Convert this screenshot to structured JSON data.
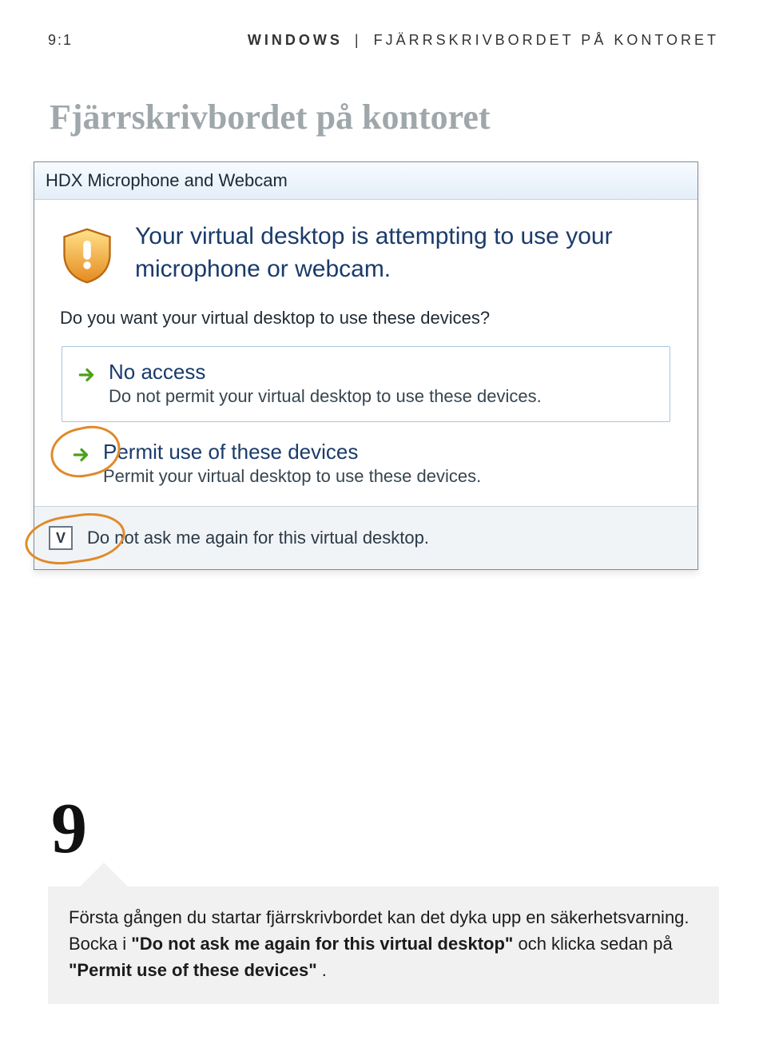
{
  "header": {
    "page_number": "9:1",
    "right_os": "WINDOWS",
    "right_title": "FJÄRRSKRIVBORDET PÅ KONTORET"
  },
  "page_title": "Fjärrskrivbordet på kontoret",
  "dialog": {
    "title": "HDX Microphone and Webcam",
    "warning": "Your virtual desktop is attempting to use your microphone or webcam.",
    "question": "Do you want your virtual desktop to use these devices?",
    "option1_title": "No access",
    "option1_sub": "Do not permit your virtual desktop to use these devices.",
    "option2_title": "Permit use of these devices",
    "option2_sub": "Permit your virtual desktop to use these devices.",
    "checkbox_label": "Do not ask me again for this virtual desktop.",
    "checkbox_mark": "V"
  },
  "callout": {
    "step": "9",
    "text_pre": "Första gången du startar fjärrskrivbordet kan det dyka upp en säker­hetsvarning. Bocka i ",
    "bold1": "\"Do not ask me again for this virtual desktop\"",
    "mid": " och klicka sedan på ",
    "bold2": "\"Permit use of these devices\"",
    "post": "."
  }
}
